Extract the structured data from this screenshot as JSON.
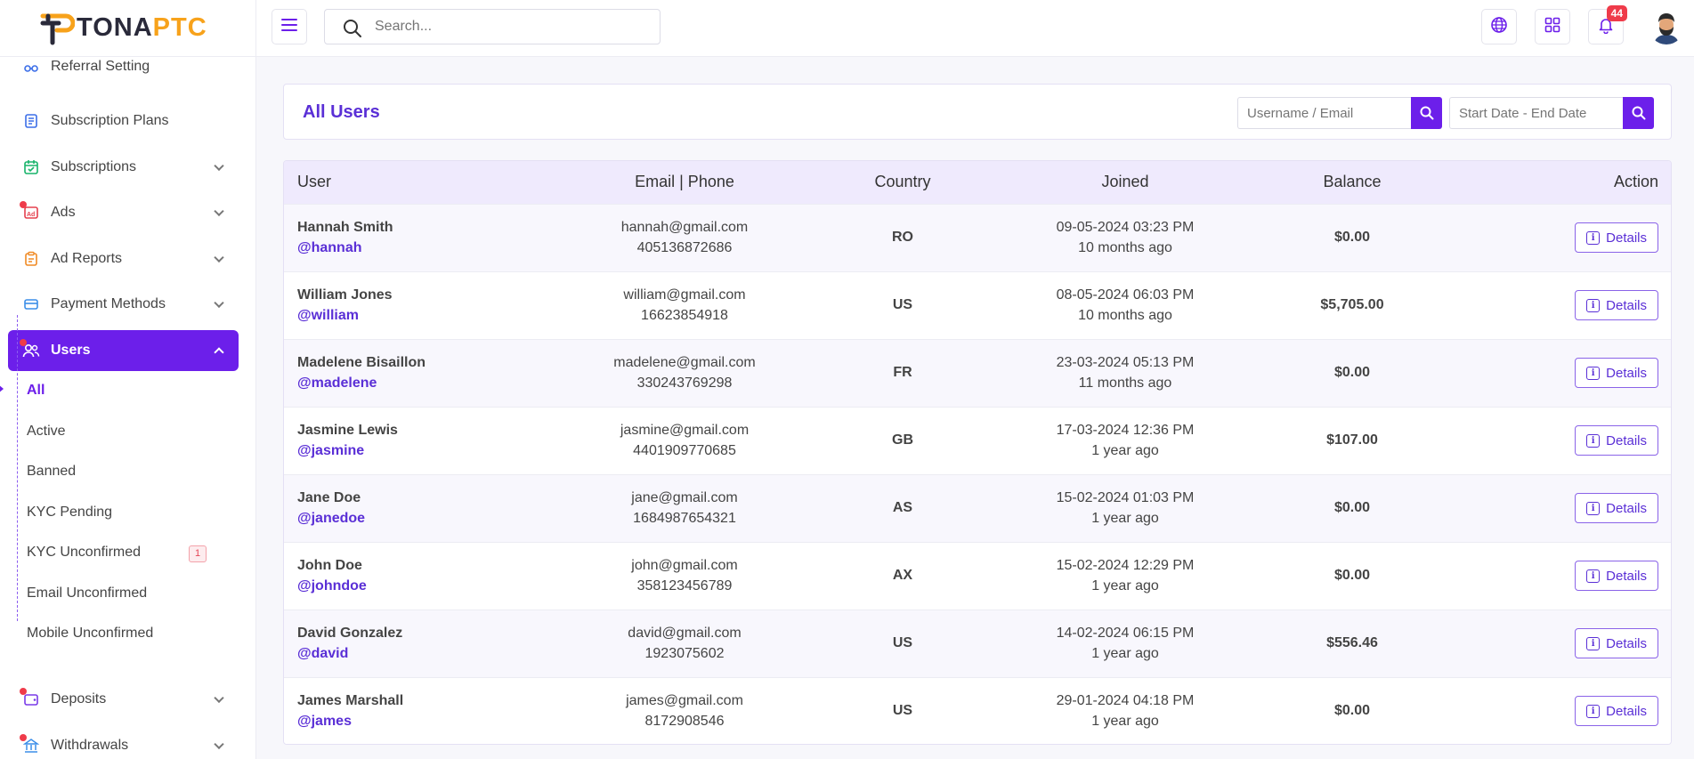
{
  "brand": {
    "logo_text_primary": "TONA",
    "logo_text_accent": "PTC",
    "accent_color": "#6c1fea",
    "logo_orange": "#f7a21b"
  },
  "topbar": {
    "search_placeholder": "Search...",
    "notification_count": "44"
  },
  "sidebar": {
    "items": [
      {
        "label": "Referral Setting",
        "icon": "referral-icon"
      },
      {
        "label": "Subscription Plans",
        "icon": "receipt-icon"
      },
      {
        "label": "Subscriptions",
        "icon": "calendar-check-icon"
      },
      {
        "label": "Ads",
        "icon": "ad-icon"
      },
      {
        "label": "Ad Reports",
        "icon": "clipboard-icon"
      },
      {
        "label": "Payment Methods",
        "icon": "credit-card-icon"
      },
      {
        "label": "Users",
        "icon": "users-icon"
      },
      {
        "label": "Deposits",
        "icon": "wallet-icon"
      },
      {
        "label": "Withdrawals",
        "icon": "bank-icon"
      }
    ],
    "users_submenu": [
      {
        "label": "All"
      },
      {
        "label": "Active"
      },
      {
        "label": "Banned"
      },
      {
        "label": "KYC Pending"
      },
      {
        "label": "KYC Unconfirmed",
        "badge": "1"
      },
      {
        "label": "Email Unconfirmed"
      },
      {
        "label": "Mobile Unconfirmed"
      }
    ]
  },
  "page": {
    "title": "All Users",
    "filter_user_placeholder": "Username / Email",
    "filter_date_placeholder": "Start Date - End Date"
  },
  "table": {
    "headers": {
      "user": "User",
      "email": "Email | Phone",
      "country": "Country",
      "joined": "Joined",
      "balance": "Balance",
      "action": "Action"
    },
    "action_label": "Details",
    "rows": [
      {
        "name": "Hannah Smith",
        "handle": "@hannah",
        "email": "hannah@gmail.com",
        "phone": "405136872686",
        "country": "RO",
        "joined": "09-05-2024 03:23 PM",
        "ago": "10 months ago",
        "balance": "$0.00"
      },
      {
        "name": "William Jones",
        "handle": "@william",
        "email": "william@gmail.com",
        "phone": "16623854918",
        "country": "US",
        "joined": "08-05-2024 06:03 PM",
        "ago": "10 months ago",
        "balance": "$5,705.00"
      },
      {
        "name": "Madelene Bisaillon",
        "handle": "@madelene",
        "email": "madelene@gmail.com",
        "phone": "330243769298",
        "country": "FR",
        "joined": "23-03-2024 05:13 PM",
        "ago": "11 months ago",
        "balance": "$0.00"
      },
      {
        "name": "Jasmine Lewis",
        "handle": "@jasmine",
        "email": "jasmine@gmail.com",
        "phone": "4401909770685",
        "country": "GB",
        "joined": "17-03-2024 12:36 PM",
        "ago": "1 year ago",
        "balance": "$107.00"
      },
      {
        "name": "Jane Doe",
        "handle": "@janedoe",
        "email": "jane@gmail.com",
        "phone": "1684987654321",
        "country": "AS",
        "joined": "15-02-2024 01:03 PM",
        "ago": "1 year ago",
        "balance": "$0.00"
      },
      {
        "name": "John Doe",
        "handle": "@johndoe",
        "email": "john@gmail.com",
        "phone": "358123456789",
        "country": "AX",
        "joined": "15-02-2024 12:29 PM",
        "ago": "1 year ago",
        "balance": "$0.00"
      },
      {
        "name": "David Gonzalez",
        "handle": "@david",
        "email": "david@gmail.com",
        "phone": "1923075602",
        "country": "US",
        "joined": "14-02-2024 06:15 PM",
        "ago": "1 year ago",
        "balance": "$556.46"
      },
      {
        "name": "James Marshall",
        "handle": "@james",
        "email": "james@gmail.com",
        "phone": "8172908546",
        "country": "US",
        "joined": "29-01-2024 04:18 PM",
        "ago": "1 year ago",
        "balance": "$0.00"
      }
    ]
  }
}
